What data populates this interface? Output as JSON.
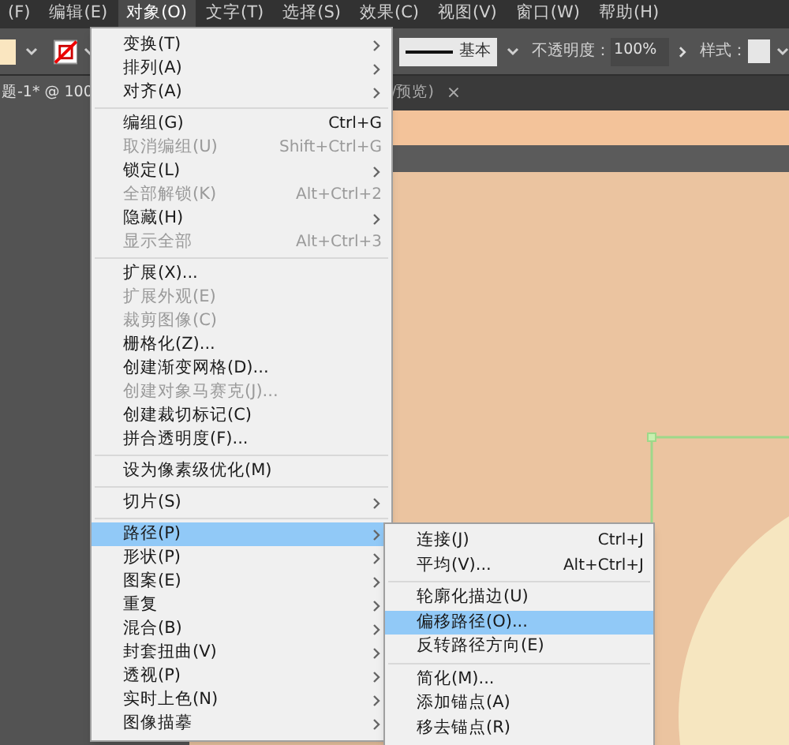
{
  "menubar": [
    {
      "label": "(F)",
      "selected": false
    },
    {
      "label": "编辑(E)",
      "selected": false
    },
    {
      "label": "对象(O)",
      "selected": true
    },
    {
      "label": "文字(T)",
      "selected": false
    },
    {
      "label": "选择(S)",
      "selected": false
    },
    {
      "label": "效果(C)",
      "selected": false
    },
    {
      "label": "视图(V)",
      "selected": false
    },
    {
      "label": "窗口(W)",
      "selected": false
    },
    {
      "label": "帮助(H)",
      "selected": false
    }
  ],
  "toolbar": {
    "stroke_profile": "基本",
    "opacity_label": "不透明度：",
    "opacity": "100%",
    "style_label": "样式："
  },
  "tabs": [
    {
      "label": "题-1* @ 100",
      "selected": true
    },
    {
      "label": "/预览)",
      "selected": false,
      "close": "×"
    }
  ],
  "object_menu": [
    {
      "kind": "item",
      "label": "变换(T)",
      "submenu": true,
      "disabled": false,
      "selected": false
    },
    {
      "kind": "item",
      "label": "排列(A)",
      "submenu": true,
      "disabled": false,
      "selected": false
    },
    {
      "kind": "item",
      "label": "对齐(A)",
      "submenu": true,
      "disabled": false,
      "selected": false
    },
    {
      "kind": "separator"
    },
    {
      "kind": "item",
      "label": "编组(G)",
      "shortcut": "Ctrl+G",
      "disabled": false,
      "selected": false
    },
    {
      "kind": "item",
      "label": "取消编组(U)",
      "shortcut": "Shift+Ctrl+G",
      "disabled": true,
      "selected": false
    },
    {
      "kind": "item",
      "label": "锁定(L)",
      "submenu": true,
      "disabled": false,
      "selected": false
    },
    {
      "kind": "item",
      "label": "全部解锁(K)",
      "shortcut": "Alt+Ctrl+2",
      "disabled": true,
      "selected": false
    },
    {
      "kind": "item",
      "label": "隐藏(H)",
      "submenu": true,
      "disabled": false,
      "selected": false
    },
    {
      "kind": "item",
      "label": "显示全部",
      "shortcut": "Alt+Ctrl+3",
      "disabled": true,
      "selected": false
    },
    {
      "kind": "separator"
    },
    {
      "kind": "item",
      "label": "扩展(X)...",
      "disabled": false,
      "selected": false
    },
    {
      "kind": "item",
      "label": "扩展外观(E)",
      "disabled": true,
      "selected": false
    },
    {
      "kind": "item",
      "label": "裁剪图像(C)",
      "disabled": true,
      "selected": false
    },
    {
      "kind": "item",
      "label": "栅格化(Z)...",
      "disabled": false,
      "selected": false
    },
    {
      "kind": "item",
      "label": "创建渐变网格(D)...",
      "disabled": false,
      "selected": false
    },
    {
      "kind": "item",
      "label": "创建对象马赛克(J)...",
      "disabled": true,
      "selected": false
    },
    {
      "kind": "item",
      "label": "创建裁切标记(C)",
      "disabled": false,
      "selected": false
    },
    {
      "kind": "item",
      "label": "拼合透明度(F)...",
      "disabled": false,
      "selected": false
    },
    {
      "kind": "separator"
    },
    {
      "kind": "item",
      "label": "设为像素级优化(M)",
      "disabled": false,
      "selected": false
    },
    {
      "kind": "separator"
    },
    {
      "kind": "item",
      "label": "切片(S)",
      "submenu": true,
      "disabled": false,
      "selected": false
    },
    {
      "kind": "separator"
    },
    {
      "kind": "item",
      "label": "路径(P)",
      "submenu": true,
      "disabled": false,
      "selected": true
    },
    {
      "kind": "item",
      "label": "形状(P)",
      "submenu": true,
      "disabled": false,
      "selected": false
    },
    {
      "kind": "item",
      "label": "图案(E)",
      "submenu": true,
      "disabled": false,
      "selected": false
    },
    {
      "kind": "item",
      "label": "重复",
      "submenu": true,
      "disabled": false,
      "selected": false
    },
    {
      "kind": "item",
      "label": "混合(B)",
      "submenu": true,
      "disabled": false,
      "selected": false
    },
    {
      "kind": "item",
      "label": "封套扭曲(V)",
      "submenu": true,
      "disabled": false,
      "selected": false
    },
    {
      "kind": "item",
      "label": "透视(P)",
      "submenu": true,
      "disabled": false,
      "selected": false
    },
    {
      "kind": "item",
      "label": "实时上色(N)",
      "submenu": true,
      "disabled": false,
      "selected": false
    },
    {
      "kind": "item",
      "label": "图像描摹",
      "submenu": true,
      "disabled": false,
      "selected": false
    }
  ],
  "path_submenu": [
    {
      "kind": "item",
      "label": "连接(J)",
      "shortcut": "Ctrl+J",
      "disabled": false,
      "selected": false
    },
    {
      "kind": "item",
      "label": "平均(V)...",
      "shortcut": "Alt+Ctrl+J",
      "disabled": false,
      "selected": false
    },
    {
      "kind": "separator"
    },
    {
      "kind": "item",
      "label": "轮廓化描边(U)",
      "disabled": false,
      "selected": false
    },
    {
      "kind": "item",
      "label": "偏移路径(O)...",
      "disabled": false,
      "selected": true
    },
    {
      "kind": "item",
      "label": "反转路径方向(E)",
      "disabled": false,
      "selected": false
    },
    {
      "kind": "separator"
    },
    {
      "kind": "item",
      "label": "简化(M)...",
      "disabled": false,
      "selected": false
    },
    {
      "kind": "item",
      "label": "添加锚点(A)",
      "disabled": false,
      "selected": false
    },
    {
      "kind": "item",
      "label": "移去锚点(R)",
      "disabled": false,
      "selected": false
    }
  ]
}
